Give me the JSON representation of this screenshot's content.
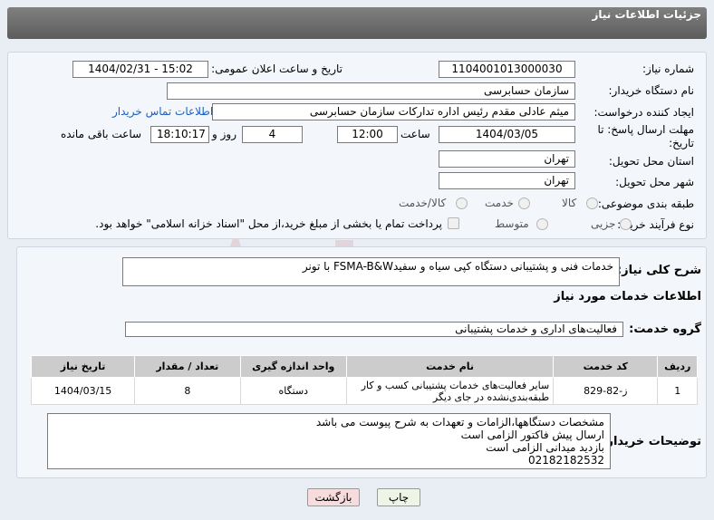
{
  "header": {
    "title": "جزئیات اطلاعات نیاز"
  },
  "labels": {
    "need_number": "شماره نیاز:",
    "announce_datetime": "تاریخ و ساعت اعلان عمومی:",
    "buyer_org": "نام دستگاه خریدار:",
    "requester": "ایجاد کننده درخواست:",
    "contact_link": "اطلاعات تماس خریدار",
    "deadline": "مهلت ارسال پاسخ: تا تاریخ:",
    "time_word": "ساعت",
    "day_and": "روز و",
    "remaining": "ساعت باقی مانده",
    "province": "استان محل تحویل:",
    "city": "شهر محل تحویل:",
    "category": "طبقه بندی موضوعی:",
    "process_type": "نوع فرآیند خرید :",
    "general_desc": "شرح کلی نیاز:",
    "services_info": "اطلاعات خدمات مورد نیاز",
    "service_group": "گروه خدمت:",
    "buyer_notes": "توضیحات خریدار:"
  },
  "values": {
    "need_number": "1104001013000030",
    "announce_datetime": "1404/02/31 - 15:02",
    "buyer_org": "سازمان حسابرسی",
    "requester": "میثم عادلی مقدم رئیس اداره تدارکات سازمان حسابرسی",
    "deadline_date": "1404/03/05",
    "deadline_time": "12:00",
    "days_left": "4",
    "time_left": "18:10:17",
    "province": "تهران",
    "city": "تهران",
    "general_desc": "خدمات فنی و پشتیبانی دستگاه کپی سیاه و سفیدFSMA-B&W با تونر",
    "service_group": "فعالیت‌های اداری و خدمات پشتیبانی",
    "buyer_notes": "مشخصات دستگاهها،الزامات و تعهدات به شرح پیوست می باشد\nارسال پیش فاکتور الزامی است\nبازدید میدانی الزامی است\n02182182532"
  },
  "category_options": [
    "کالا",
    "خدمت",
    "کالا/خدمت"
  ],
  "process_options": [
    "جزیی",
    "متوسط"
  ],
  "payment_note": "پرداخت تمام یا بخشی از مبلغ خرید،از محل \"اسناد خزانه اسلامی\" خواهد بود.",
  "table": {
    "headers": [
      "ردیف",
      "کد خدمت",
      "نام خدمت",
      "واحد اندازه گیری",
      "تعداد / مقدار",
      "تاریخ نیاز"
    ],
    "rows": [
      {
        "row": "1",
        "code": "ز-82-829",
        "name": "سایر فعالیت‌های خدمات پشتیبانی کسب و کار طبقه‌بندی‌نشده در جای دیگر",
        "unit": "دستگاه",
        "qty": "8",
        "date": "1404/03/15"
      }
    ]
  },
  "buttons": {
    "print": "چاپ",
    "back": "بازگشت"
  },
  "colors": {
    "header_bg": "#6b6b6b",
    "link": "#1f5fbf",
    "back_btn": "#f6dcdc",
    "print_btn": "#eef5e6"
  }
}
